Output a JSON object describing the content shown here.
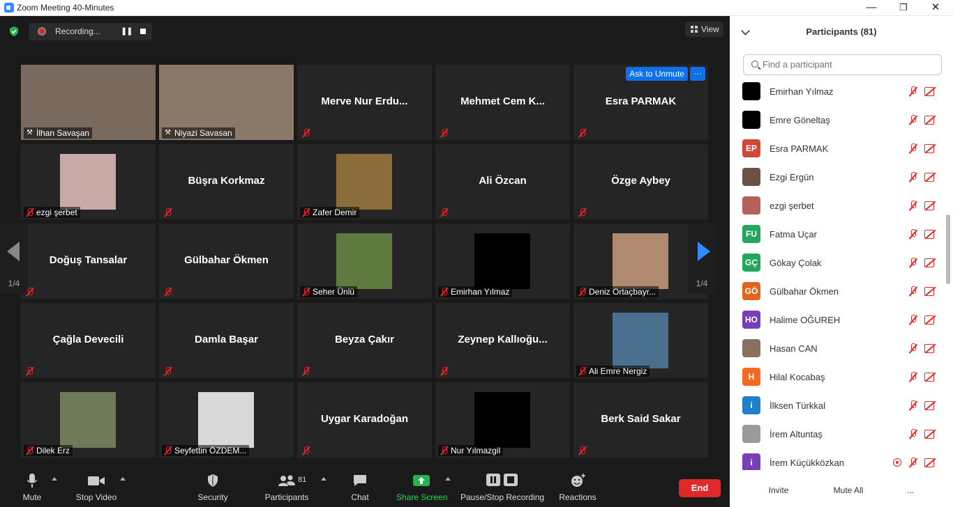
{
  "window": {
    "title": "Zoom Meeting 40-Minutes",
    "minimize": "—",
    "restore": "❐",
    "close": "✕"
  },
  "topbar": {
    "recording_label": "Recording...",
    "view_label": "View"
  },
  "tiles": [
    {
      "name": "",
      "label": "İlhan Savaşan",
      "photo": "#7a6a5e",
      "full": true,
      "pinned": true
    },
    {
      "name": "",
      "label": "Niyazi Savasan",
      "photo": "#8a7868",
      "full": true,
      "pinned": true,
      "active": true
    },
    {
      "name": "Merve  Nur  Erdu...",
      "label": ""
    },
    {
      "name": "Mehmet  Cem  K...",
      "label": ""
    },
    {
      "name": "Esra PARMAK",
      "label": ""
    },
    {
      "name": "",
      "label": "ezgi şerbet",
      "photo": "#c9a9a6"
    },
    {
      "name": "Büşra Korkmaz",
      "label": ""
    },
    {
      "name": "",
      "label": "Zafer Demir",
      "photo": "#8a6d3b"
    },
    {
      "name": "Ali Özcan",
      "label": ""
    },
    {
      "name": "Özge Aybey",
      "label": ""
    },
    {
      "name": "Doğuş Tansalar",
      "label": ""
    },
    {
      "name": "Gülbahar Ökmen",
      "label": ""
    },
    {
      "name": "",
      "label": "Seher  Ünlü",
      "photo": "#5e7a3e"
    },
    {
      "name": "",
      "label": "Emirhan Yılmaz",
      "photo": "#000000"
    },
    {
      "name": "",
      "label": "Deniz Ortaçbayr...",
      "photo": "#b08a6e"
    },
    {
      "name": "Çağla Devecili",
      "label": ""
    },
    {
      "name": "Damla Başar",
      "label": ""
    },
    {
      "name": "Beyza Çakır",
      "label": ""
    },
    {
      "name": "Zeynep  Kallıoğu...",
      "label": ""
    },
    {
      "name": "",
      "label": "Ali Emre Nergiz",
      "photo": "#4a6e8e"
    },
    {
      "name": "",
      "label": "Dilek Erz",
      "photo": "#6e7a5a"
    },
    {
      "name": "",
      "label": "Seyfettin ÖZDEM...",
      "photo": "#d8d8d8"
    },
    {
      "name": "Uygar Karadoğan",
      "label": ""
    },
    {
      "name": "",
      "label": "Nur Yılmazgil",
      "photo": "#000000"
    },
    {
      "name": "Berk Said Sakar",
      "label": ""
    }
  ],
  "tile_actions": {
    "ask_unmute": "Ask to Unmute",
    "more": "···"
  },
  "pager": {
    "left": "1/4",
    "right": "1/4"
  },
  "toolbar": {
    "mute": "Mute",
    "stop_video": "Stop Video",
    "security": "Security",
    "participants": "Participants",
    "participants_count": "81",
    "chat": "Chat",
    "share_screen": "Share Screen",
    "pause_stop_recording": "Pause/Stop Recording",
    "reactions": "Reactions",
    "end": "End"
  },
  "panel": {
    "title": "Participants (81)",
    "search_placeholder": "Find a participant",
    "participants": [
      {
        "name": "Emirhan Yılmaz",
        "initials": "",
        "color": "#000000"
      },
      {
        "name": "Emre Göneltaş",
        "initials": "",
        "color": "#000000"
      },
      {
        "name": "Esra PARMAK",
        "initials": "EP",
        "color": "#d14836"
      },
      {
        "name": "Ezgi Ergün",
        "initials": "",
        "color": "#6b5144"
      },
      {
        "name": "ezgi şerbet",
        "initials": "",
        "color": "#b5605a"
      },
      {
        "name": "Fatma Uçar",
        "initials": "FU",
        "color": "#24a65d"
      },
      {
        "name": "Gökay Çolak",
        "initials": "GÇ",
        "color": "#24a65d"
      },
      {
        "name": "Gülbahar Ökmen",
        "initials": "GÖ",
        "color": "#e0661e"
      },
      {
        "name": "Halime OĞUREH",
        "initials": "HO",
        "color": "#7a3fb4"
      },
      {
        "name": "Hasan CAN",
        "initials": "",
        "color": "#8a7060"
      },
      {
        "name": "Hilal Kocabaş",
        "initials": "H",
        "color": "#f26b21"
      },
      {
        "name": "İlksen Türkkal",
        "initials": "i",
        "color": "#1f7fc9"
      },
      {
        "name": "İrem Altuntaş",
        "initials": "",
        "color": "#9a9a9a"
      },
      {
        "name": "İrem Küçükközkan",
        "initials": "i",
        "color": "#7a3fb4",
        "recording": true
      }
    ],
    "invite": "Invite",
    "mute_all": "Mute All",
    "more": "..."
  }
}
